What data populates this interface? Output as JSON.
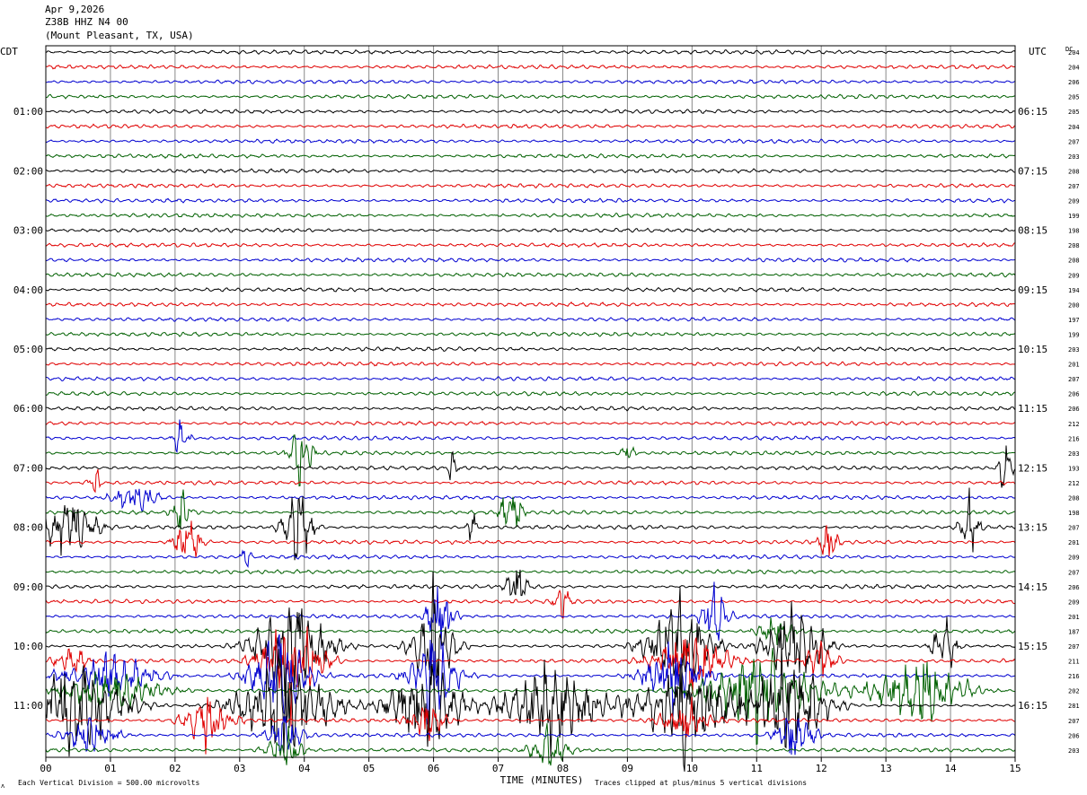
{
  "header": {
    "date": "Apr 9,2026",
    "station": "Z38B HHZ N4 00",
    "location": "(Mount Pleasant, TX, USA)"
  },
  "axes": {
    "left_zone": "CDT",
    "right_zone": "UTC",
    "dc_label": "DC",
    "x_label": "TIME (MINUTES)",
    "footer_left": "Each Vertical Division =  500.00 microvolts",
    "footer_right": "Traces clipped at plus/minus 5 vertical divisions",
    "corner_mark": "ʌ"
  },
  "chart_data": {
    "type": "line",
    "title": "",
    "xlabel": "TIME (MINUTES)",
    "ylabel": "",
    "xlim": [
      0,
      15
    ],
    "x_ticks": [
      "00",
      "01",
      "02",
      "03",
      "04",
      "05",
      "06",
      "07",
      "08",
      "09",
      "10",
      "11",
      "12",
      "13",
      "14",
      "15"
    ],
    "grid": true,
    "trace_colors": [
      "#000000",
      "#e00000",
      "#0000d0",
      "#006000"
    ],
    "left_hour_labels": [
      "01:00",
      "02:00",
      "03:00",
      "04:00",
      "05:00",
      "06:00",
      "07:00",
      "08:00",
      "09:00",
      "10:00",
      "11:00"
    ],
    "right_hour_labels": [
      "06:15",
      "07:15",
      "08:15",
      "09:15",
      "10:15",
      "11:15",
      "12:15",
      "13:15",
      "14:15",
      "15:15",
      "16:15"
    ],
    "dc_offsets": [
      204,
      204,
      206,
      205,
      205,
      204,
      207,
      203,
      208,
      207,
      209,
      199,
      198,
      208,
      208,
      209,
      194,
      200,
      197,
      199,
      203,
      201,
      207,
      206,
      206,
      212,
      216,
      203,
      193,
      212,
      208,
      198,
      207,
      201,
      209,
      207,
      206,
      209,
      201,
      187,
      207,
      211,
      216,
      202,
      281,
      207,
      206,
      203
    ],
    "events": [
      {
        "row": 26,
        "minute": 2.1,
        "amp": 2.0,
        "dur": 0.25
      },
      {
        "row": 27,
        "minute": 3.95,
        "amp": 3.5,
        "dur": 0.35
      },
      {
        "row": 27,
        "minute": 9.0,
        "amp": 1.5,
        "dur": 0.2
      },
      {
        "row": 28,
        "minute": 6.3,
        "amp": 1.8,
        "dur": 0.15
      },
      {
        "row": 28,
        "minute": 14.85,
        "amp": 2.5,
        "dur": 0.25
      },
      {
        "row": 29,
        "minute": 0.75,
        "amp": 1.6,
        "dur": 0.2
      },
      {
        "row": 30,
        "minute": 1.4,
        "amp": 1.6,
        "dur": 0.7
      },
      {
        "row": 31,
        "minute": 2.1,
        "amp": 1.8,
        "dur": 0.3
      },
      {
        "row": 31,
        "minute": 7.2,
        "amp": 3.0,
        "dur": 0.35
      },
      {
        "row": 32,
        "minute": 0.35,
        "amp": 3.5,
        "dur": 0.8
      },
      {
        "row": 32,
        "minute": 3.9,
        "amp": 4.0,
        "dur": 0.5
      },
      {
        "row": 32,
        "minute": 6.6,
        "amp": 1.8,
        "dur": 0.15
      },
      {
        "row": 32,
        "minute": 14.3,
        "amp": 2.8,
        "dur": 0.3
      },
      {
        "row": 33,
        "minute": 2.2,
        "amp": 2.4,
        "dur": 0.45
      },
      {
        "row": 33,
        "minute": 12.1,
        "amp": 2.0,
        "dur": 0.3
      },
      {
        "row": 34,
        "minute": 3.1,
        "amp": 1.5,
        "dur": 0.15
      },
      {
        "row": 36,
        "minute": 7.3,
        "amp": 2.2,
        "dur": 0.35
      },
      {
        "row": 37,
        "minute": 8.0,
        "amp": 2.4,
        "dur": 0.25
      },
      {
        "row": 38,
        "minute": 6.1,
        "amp": 3.2,
        "dur": 0.45
      },
      {
        "row": 38,
        "minute": 10.35,
        "amp": 2.8,
        "dur": 0.45
      },
      {
        "row": 39,
        "minute": 11.3,
        "amp": 1.5,
        "dur": 0.6
      },
      {
        "row": 40,
        "minute": 3.8,
        "amp": 5.0,
        "dur": 1.2
      },
      {
        "row": 40,
        "minute": 6.0,
        "amp": 5.0,
        "dur": 0.7
      },
      {
        "row": 40,
        "minute": 9.8,
        "amp": 5.0,
        "dur": 1.0
      },
      {
        "row": 40,
        "minute": 11.6,
        "amp": 5.0,
        "dur": 0.9
      },
      {
        "row": 40,
        "minute": 13.9,
        "amp": 3.0,
        "dur": 0.4
      },
      {
        "row": 41,
        "minute": 0.4,
        "amp": 1.8,
        "dur": 0.5
      },
      {
        "row": 41,
        "minute": 3.8,
        "amp": 5.0,
        "dur": 1.0
      },
      {
        "row": 41,
        "minute": 10.0,
        "amp": 3.0,
        "dur": 1.2
      },
      {
        "row": 41,
        "minute": 12.0,
        "amp": 2.2,
        "dur": 0.5
      },
      {
        "row": 42,
        "minute": 1.0,
        "amp": 2.2,
        "dur": 1.5
      },
      {
        "row": 42,
        "minute": 3.6,
        "amp": 4.0,
        "dur": 1.0
      },
      {
        "row": 42,
        "minute": 6.0,
        "amp": 4.0,
        "dur": 0.8
      },
      {
        "row": 42,
        "minute": 9.7,
        "amp": 3.0,
        "dur": 1.0
      },
      {
        "row": 43,
        "minute": 1.0,
        "amp": 2.0,
        "dur": 1.6
      },
      {
        "row": 43,
        "minute": 11.0,
        "amp": 4.0,
        "dur": 1.8
      },
      {
        "row": 43,
        "minute": 13.5,
        "amp": 3.5,
        "dur": 1.5
      },
      {
        "row": 44,
        "minute": 0.5,
        "amp": 5.0,
        "dur": 1.5
      },
      {
        "row": 44,
        "minute": 3.7,
        "amp": 5.0,
        "dur": 1.5
      },
      {
        "row": 44,
        "minute": 5.9,
        "amp": 5.0,
        "dur": 1.2
      },
      {
        "row": 44,
        "minute": 7.8,
        "amp": 5.0,
        "dur": 1.5
      },
      {
        "row": 44,
        "minute": 9.9,
        "amp": 5.0,
        "dur": 1.5
      },
      {
        "row": 44,
        "minute": 11.5,
        "amp": 5.0,
        "dur": 1.2
      },
      {
        "row": 45,
        "minute": 2.5,
        "amp": 2.5,
        "dur": 0.8
      },
      {
        "row": 45,
        "minute": 5.9,
        "amp": 2.0,
        "dur": 0.6
      },
      {
        "row": 45,
        "minute": 9.9,
        "amp": 2.0,
        "dur": 0.8
      },
      {
        "row": 46,
        "minute": 0.7,
        "amp": 2.0,
        "dur": 0.8
      },
      {
        "row": 46,
        "minute": 3.7,
        "amp": 2.0,
        "dur": 0.6
      },
      {
        "row": 46,
        "minute": 11.6,
        "amp": 2.5,
        "dur": 0.6
      },
      {
        "row": 47,
        "minute": 3.7,
        "amp": 2.0,
        "dur": 0.6
      },
      {
        "row": 47,
        "minute": 7.8,
        "amp": 2.0,
        "dur": 0.6
      }
    ]
  }
}
